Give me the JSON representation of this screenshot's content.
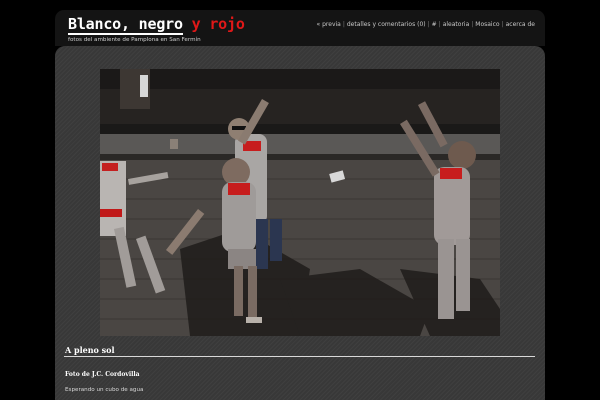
{
  "header": {
    "logo": {
      "part1": "Blanco,",
      "part2": "negro",
      "part3": "y rojo"
    },
    "tagline": "fotos del ambiente de Pamplona en San Fermín"
  },
  "nav": [
    {
      "label": "« previa"
    },
    {
      "label": "detalles y comentarios (0)"
    },
    {
      "label": "#"
    },
    {
      "label": "aleatoria"
    },
    {
      "label": "Mosaico"
    },
    {
      "label": "acerca de"
    }
  ],
  "post": {
    "title": "A pleno sol",
    "credit": "Foto de J.C. Cordovilla",
    "caption": "Esperando un cubo de agua"
  },
  "colors": {
    "accent_red": "#e01818",
    "header_bg": "#141414",
    "content_bg": "#3b3b3b",
    "text_white": "#ffffff"
  }
}
